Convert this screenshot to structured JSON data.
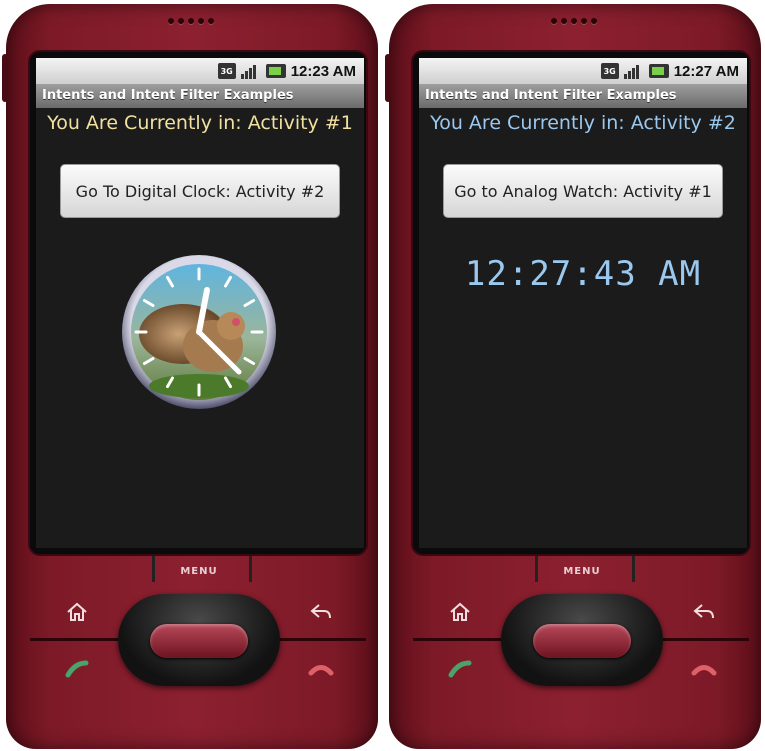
{
  "phones": [
    {
      "status_time": "12:23 AM",
      "status_network": "3G",
      "app_title": "Intents and Intent Filter Examples",
      "activity_label": "You Are Currently in: Activity #1",
      "activity_label_color": "#f1e0a0",
      "button_label": "Go To Digital Clock: Activity #2",
      "widget": "analog-clock"
    },
    {
      "status_time": "12:27 AM",
      "status_network": "3G",
      "app_title": "Intents and Intent Filter Examples",
      "activity_label": "You Are Currently in: Activity #2",
      "activity_label_color": "#9bc8ee",
      "button_label": "Go to Analog Watch: Activity #1",
      "widget": "digital-clock",
      "digital_time": "12:27:43 AM"
    }
  ],
  "hardware": {
    "menu_label": "MENU",
    "icons": [
      "home-icon",
      "back-icon",
      "call-icon",
      "end-call-icon"
    ],
    "body_color": "#8c2030"
  }
}
